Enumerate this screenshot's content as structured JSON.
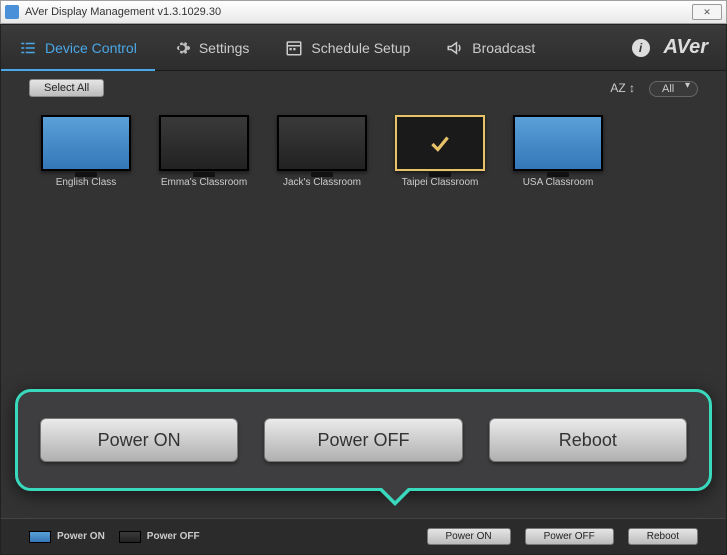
{
  "window": {
    "title": "AVer Display Management v1.3.1029.30"
  },
  "nav": {
    "device_control": "Device Control",
    "settings": "Settings",
    "schedule": "Schedule Setup",
    "broadcast": "Broadcast"
  },
  "logo": "AVer",
  "toolbar": {
    "select_all": "Select All",
    "sort_az": "AZ",
    "filter": "All"
  },
  "devices": [
    {
      "label": "English Class",
      "state": "on",
      "selected": false
    },
    {
      "label": "Emma's Classroom",
      "state": "off",
      "selected": false
    },
    {
      "label": "Jack's Classroom",
      "state": "off",
      "selected": false
    },
    {
      "label": "Taipei Classroom",
      "state": "off",
      "selected": true
    },
    {
      "label": "USA Classroom",
      "state": "on",
      "selected": false
    }
  ],
  "callout": {
    "power_on": "Power ON",
    "power_off": "Power OFF",
    "reboot": "Reboot"
  },
  "legend": {
    "on": "Power ON",
    "off": "Power OFF"
  },
  "footer_buttons": {
    "power_on": "Power ON",
    "power_off": "Power OFF",
    "reboot": "Reboot"
  }
}
